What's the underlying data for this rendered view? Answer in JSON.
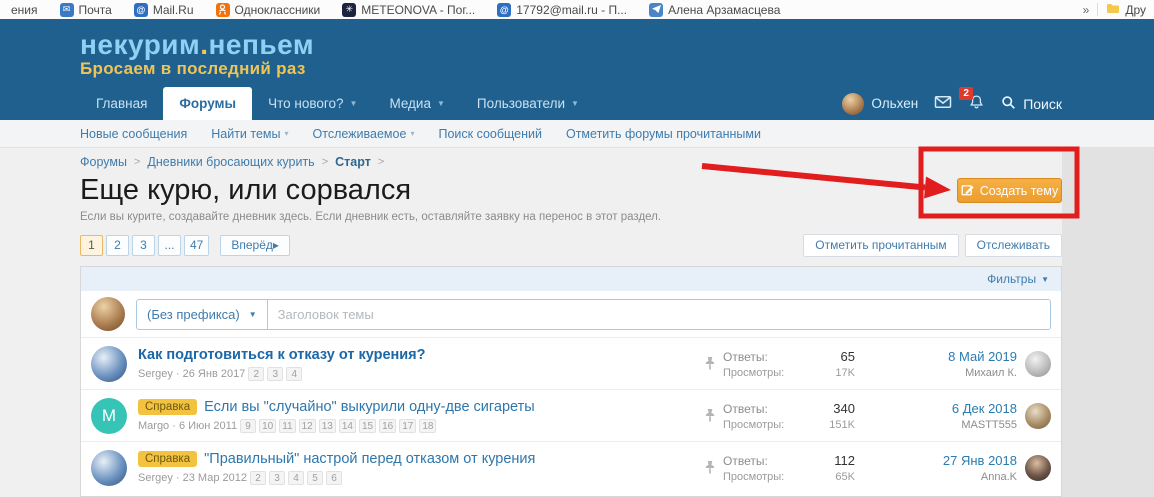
{
  "bookmarks": {
    "items": [
      {
        "label": "ения",
        "icon": "none"
      },
      {
        "label": "Почта",
        "icon": "mail-icon"
      },
      {
        "label": "Mail.Ru",
        "icon": "at-icon"
      },
      {
        "label": "Одноклассники",
        "icon": "ok-icon"
      },
      {
        "label": "METEONOVA - Пог...",
        "icon": "meteo-icon"
      },
      {
        "label": "17792@mail.ru - П...",
        "icon": "at-icon"
      },
      {
        "label": "Алена Арзамасцева",
        "icon": "social-icon"
      }
    ],
    "overflow": "»",
    "folder_label": "Дру"
  },
  "header": {
    "logo_part1": "некурим",
    "logo_dot": ".",
    "logo_part2": "непьем",
    "logo_line2": "Бросаем в последний раз"
  },
  "nav": {
    "tabs": [
      {
        "label": "Главная"
      },
      {
        "label": "Форумы"
      },
      {
        "label": "Что нового?"
      },
      {
        "label": "Медиа"
      },
      {
        "label": "Пользователи"
      }
    ],
    "username": "Ольхен",
    "alerts_badge": "2",
    "search_label": "Поиск"
  },
  "subnav": {
    "items": [
      {
        "label": "Новые сообщения"
      },
      {
        "label": "Найти темы"
      },
      {
        "label": "Отслеживаемое"
      },
      {
        "label": "Поиск сообщений"
      },
      {
        "label": "Отметить форумы прочитанными"
      }
    ]
  },
  "breadcrumb": {
    "items": [
      {
        "label": "Форумы"
      },
      {
        "label": "Дневники бросающих курить"
      },
      {
        "label": "Старт"
      }
    ]
  },
  "page": {
    "title": "Еще курю, или сорвался",
    "description": "Если вы курите, создавайте дневник здесь. Если дневник есть, оставляйте заявку на перенос в этот раздел.",
    "create_button_label": "Создать тему"
  },
  "toolbar": {
    "pages": [
      "1",
      "2",
      "3",
      "...",
      "47"
    ],
    "next_label": "Вперёд",
    "next_arrow": "▸",
    "mark_read_label": "Отметить прочитанным",
    "watch_label": "Отслеживать"
  },
  "filters": {
    "label": "Фильтры"
  },
  "composer": {
    "prefix_value": "(Без префикса)",
    "title_placeholder": "Заголовок темы"
  },
  "labels": {
    "replies": "Ответы:",
    "views": "Просмотры:"
  },
  "threads": [
    {
      "title": "Как подготовиться к отказу от курения?",
      "byline": "Sergey · 26 Янв 2017",
      "pages": [
        "2",
        "3",
        "4"
      ],
      "replies": "65",
      "views": "17K",
      "last_date": "8 Май 2019",
      "last_user": "Михаил К."
    },
    {
      "badge": "Справка",
      "title": "Если вы \"случайно\" выкурили одну-две сигареты",
      "byline": "Margo · 6 Июн 2011",
      "pages": [
        "9",
        "10",
        "11",
        "12",
        "13",
        "14",
        "15",
        "16",
        "17",
        "18"
      ],
      "replies": "340",
      "views": "151K",
      "last_date": "6 Дек 2018",
      "last_user": "MASTT555",
      "avatar_letter": "M"
    },
    {
      "badge": "Справка",
      "title": "\"Правильный\" настрой перед отказом от курения",
      "byline": "Sergey · 23 Мар 2012",
      "pages": [
        "2",
        "3",
        "4",
        "5",
        "6"
      ],
      "replies": "112",
      "views": "65K",
      "last_date": "27 Янв 2018",
      "last_user": "Anna.K"
    }
  ],
  "colors": {
    "header_blue": "#20608e",
    "link_blue": "#3f7cad",
    "accent_orange": "#f0a23c",
    "badge_yellow": "#f3c340",
    "annotation_red": "#e11d1d"
  }
}
